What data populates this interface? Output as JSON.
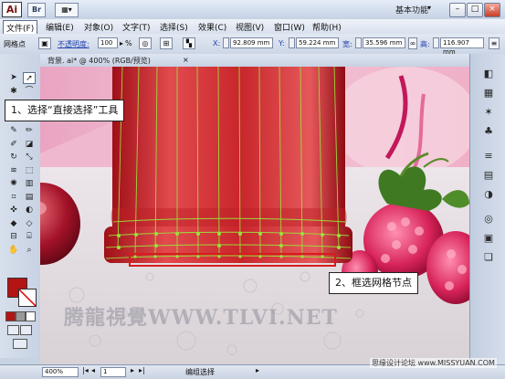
{
  "app": {
    "logo_text": "Ai",
    "bridge_label": "Br",
    "workspace_label": "基本功能",
    "workspace_arrow": "▾"
  },
  "window_controls": {
    "minimize": "–",
    "restore": "□",
    "close": "×"
  },
  "menu": [
    "文件(F)",
    "编辑(E)",
    "对象(O)",
    "文字(T)",
    "选择(S)",
    "效果(C)",
    "视图(V)",
    "窗口(W)",
    "帮助(H)"
  ],
  "control_bar": {
    "mode_label": "网格点",
    "opacity_label": "不透明度:",
    "opacity_value": "100",
    "opacity_unit": "%",
    "x_label": "X:",
    "x_value": "92.809 mm",
    "y_label": "Y:",
    "y_value": "59.224 mm",
    "w_label": "宽:",
    "w_value": "35.596 mm",
    "h_label": "高:",
    "h_value": "116.907 mm"
  },
  "document": {
    "tab_label": "背景. ai* @ 400% (RGB/预览)",
    "close": "×"
  },
  "callouts": {
    "step1": "1、选择“直接选择”工具",
    "step2": "2、框选网格节点"
  },
  "watermark": "腾龍視覺WWW.TLVI.NET",
  "credit": "思缘设计论坛 www.MISSYUAN.COM",
  "status": {
    "zoom": "400%",
    "page": "1",
    "tool_name": "编组选择"
  },
  "colors": {
    "jar_red": "#c8262b",
    "mesh_green": "#9be23c",
    "fill_swatch": "#b31414",
    "selection_red": "#d61c1c"
  },
  "tools": [
    "selection-tool",
    "direct-selection-tool",
    "magic-wand-tool",
    "lasso-tool",
    "pen-tool",
    "type-tool",
    "line-tool",
    "rectangle-tool",
    "paintbrush-tool",
    "pencil-tool",
    "blob-brush-tool",
    "eraser-tool",
    "rotate-tool",
    "scale-tool",
    "warp-tool",
    "free-transform-tool",
    "symbol-sprayer-tool",
    "column-graph-tool",
    "mesh-tool",
    "gradient-tool",
    "eyedropper-tool",
    "blend-tool",
    "live-paint-tool",
    "live-paint-select-tool",
    "artboard-tool",
    "slice-tool",
    "hand-tool",
    "zoom-tool"
  ],
  "right_panels": [
    "color-panel-icon",
    "swatches-panel-icon",
    "brushes-panel-icon",
    "symbols-panel-icon",
    "stroke-panel-icon",
    "gradient-panel-icon",
    "transparency-panel-icon",
    "appearance-panel-icon",
    "graphic-styles-panel-icon",
    "layers-panel-icon"
  ]
}
